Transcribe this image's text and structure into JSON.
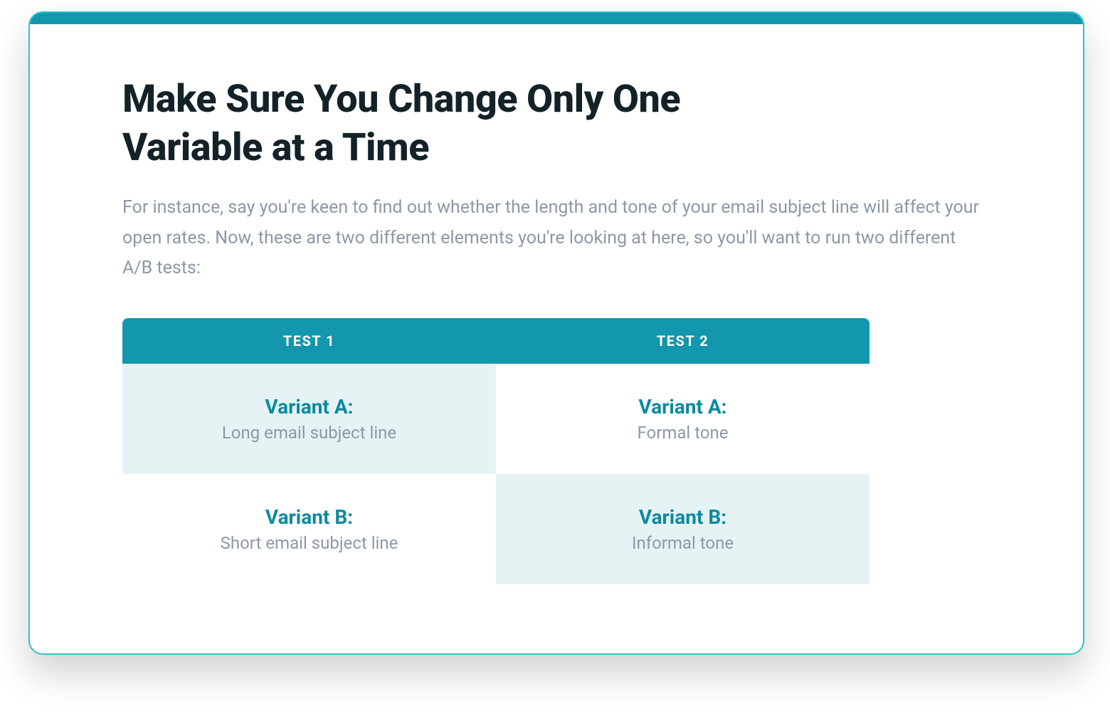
{
  "title": "Make Sure You Change Only One Variable at a Time",
  "description": "For instance, say you're keen to find out whether the length and tone of your email subject line will affect your open rates. Now, these are two different elements you're looking at here, so you'll want to run two different A/B tests:",
  "table": {
    "headers": [
      "TEST 1",
      "TEST 2"
    ],
    "rows": [
      {
        "test1": {
          "label": "Variant A:",
          "desc": "Long email subject line"
        },
        "test2": {
          "label": "Variant A:",
          "desc": "Formal tone"
        }
      },
      {
        "test1": {
          "label": "Variant B:",
          "desc": "Short email subject line"
        },
        "test2": {
          "label": "Variant B:",
          "desc": "Informal tone"
        }
      }
    ]
  },
  "colors": {
    "accent": "#1297ae",
    "accent_light": "#e5f3f5",
    "heading": "#132228",
    "body_text": "#8d98a6",
    "card_border": "#2ec4c4"
  }
}
